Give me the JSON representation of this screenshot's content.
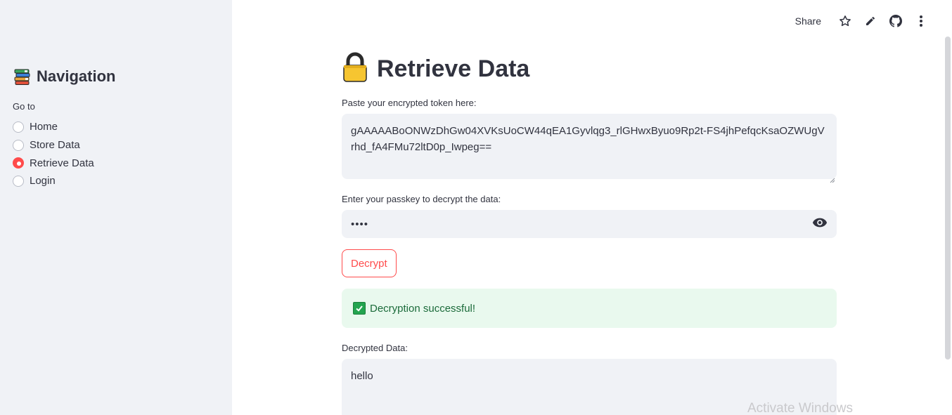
{
  "sidebar": {
    "title": "Navigation",
    "goto_label": "Go to",
    "items": [
      {
        "label": "Home",
        "selected": false
      },
      {
        "label": "Store Data",
        "selected": false
      },
      {
        "label": "Retrieve Data",
        "selected": true
      },
      {
        "label": "Login",
        "selected": false
      }
    ]
  },
  "toolbar": {
    "share_label": "Share",
    "icons": [
      "star-icon",
      "pencil-icon",
      "github-icon",
      "more-vertical-icon"
    ]
  },
  "main": {
    "title": "Retrieve Data",
    "title_icon": "lock-icon",
    "token_label": "Paste your encrypted token here:",
    "token_value": "gAAAAABoONWzDhGw04XVKsUoCW44qEA1Gyvlqg3_rlGHwxByuo9Rp2t-FS4jhPefqcKsaOZWUgVrhd_fA4FMu72ltD0p_Iwpeg==",
    "passkey_label": "Enter your passkey to decrypt the data:",
    "passkey_value": "••••",
    "decrypt_label": "Decrypt",
    "success_message": "Decryption successful!",
    "decrypted_label": "Decrypted Data:",
    "decrypted_value": "hello"
  },
  "watermark": "Activate Windows",
  "colors": {
    "accent": "#ff4b4b",
    "sidebar_bg": "#f0f2f6",
    "success_bg": "#e9f9ee",
    "success_text": "#1b6b3a"
  }
}
